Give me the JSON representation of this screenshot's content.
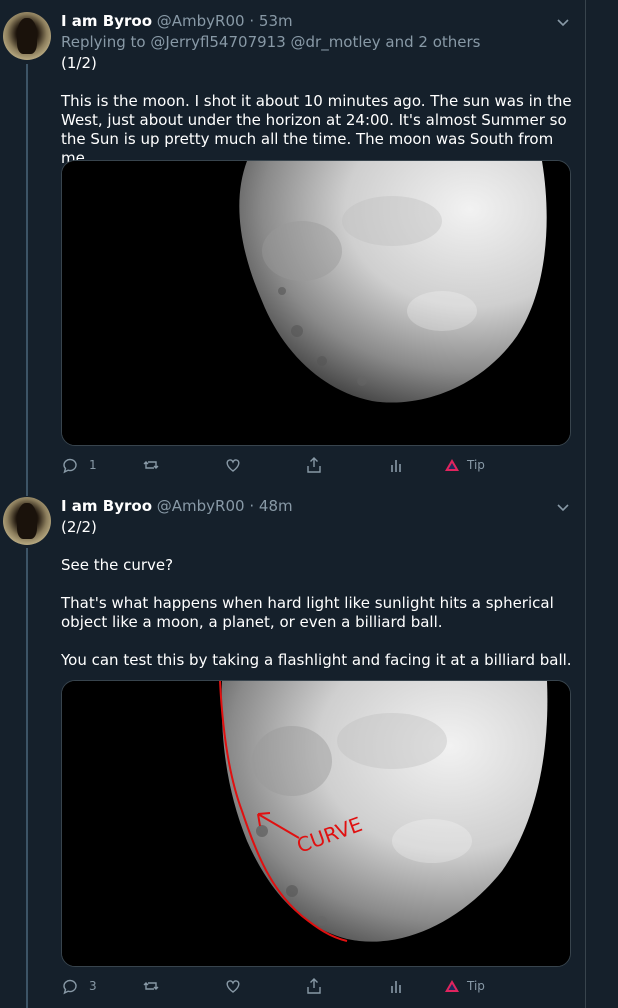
{
  "tweets": [
    {
      "name": "I am Byroo",
      "handle": "@AmbyR00",
      "sep": "·",
      "time": "53m",
      "replying_prefix": "Replying to ",
      "replying_links": "@Jerryfl54707913 @dr_motley and 2 others",
      "paragraphs": [
        "(1/2)",
        "This is the moon. I shot it about 10 minutes ago. The sun was in the West, just about under the horizon at 24:00. It's almost Summer so the Sun is up pretty much all the time. The moon was South from me."
      ],
      "reply_count": "1",
      "tip_label": "Tip"
    },
    {
      "name": "I am Byroo",
      "handle": "@AmbyR00",
      "sep": "·",
      "time": "48m",
      "paragraphs": [
        "(2/2)",
        "See the curve?",
        "That's what happens when hard light like sunlight hits a spherical object like a moon, a planet, or even a billiard ball.",
        "You can test this by taking a flashlight and facing it at a billiard ball."
      ],
      "image_annotation": "CURVE",
      "reply_count": "3",
      "tip_label": "Tip"
    }
  ],
  "icons": [
    "chevron-down-icon",
    "reply-icon",
    "retweet-icon",
    "like-icon",
    "share-icon",
    "analytics-icon",
    "tip-icon"
  ],
  "colors": {
    "background": "#15202b",
    "link": "#1da1f2",
    "muted": "#8899a6",
    "annotation": "#e01010"
  }
}
